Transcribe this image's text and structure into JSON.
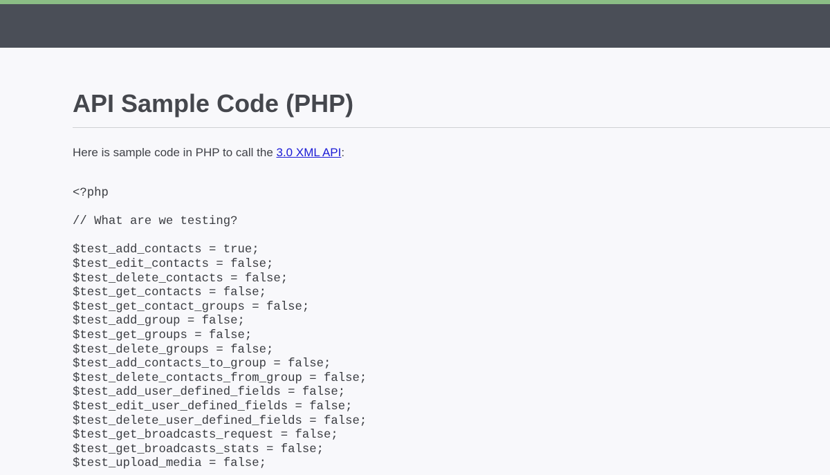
{
  "page": {
    "title": "API Sample Code (PHP)",
    "intro_prefix": "Here is sample code in PHP to call the ",
    "intro_link": "3.0 XML API",
    "intro_suffix": ":"
  },
  "colors": {
    "accent_bar": "#8bbd85",
    "header_bg": "#4a4e57",
    "page_bg": "#f8f8fb",
    "link": "#1a1ad6"
  },
  "code": {
    "language": "php",
    "lines": [
      "<?php",
      "",
      "// What are we testing?",
      "",
      "$test_add_contacts = true;",
      "$test_edit_contacts = false;",
      "$test_delete_contacts = false;",
      "$test_get_contacts = false;",
      "$test_get_contact_groups = false;",
      "$test_add_group = false;",
      "$test_get_groups = false;",
      "$test_delete_groups = false;",
      "$test_add_contacts_to_group = false;",
      "$test_delete_contacts_from_group = false;",
      "$test_add_user_defined_fields = false;",
      "$test_edit_user_defined_fields = false;",
      "$test_delete_user_defined_fields = false;",
      "$test_get_broadcasts_request = false;",
      "$test_get_broadcasts_stats = false;",
      "$test_upload_media = false;"
    ]
  }
}
